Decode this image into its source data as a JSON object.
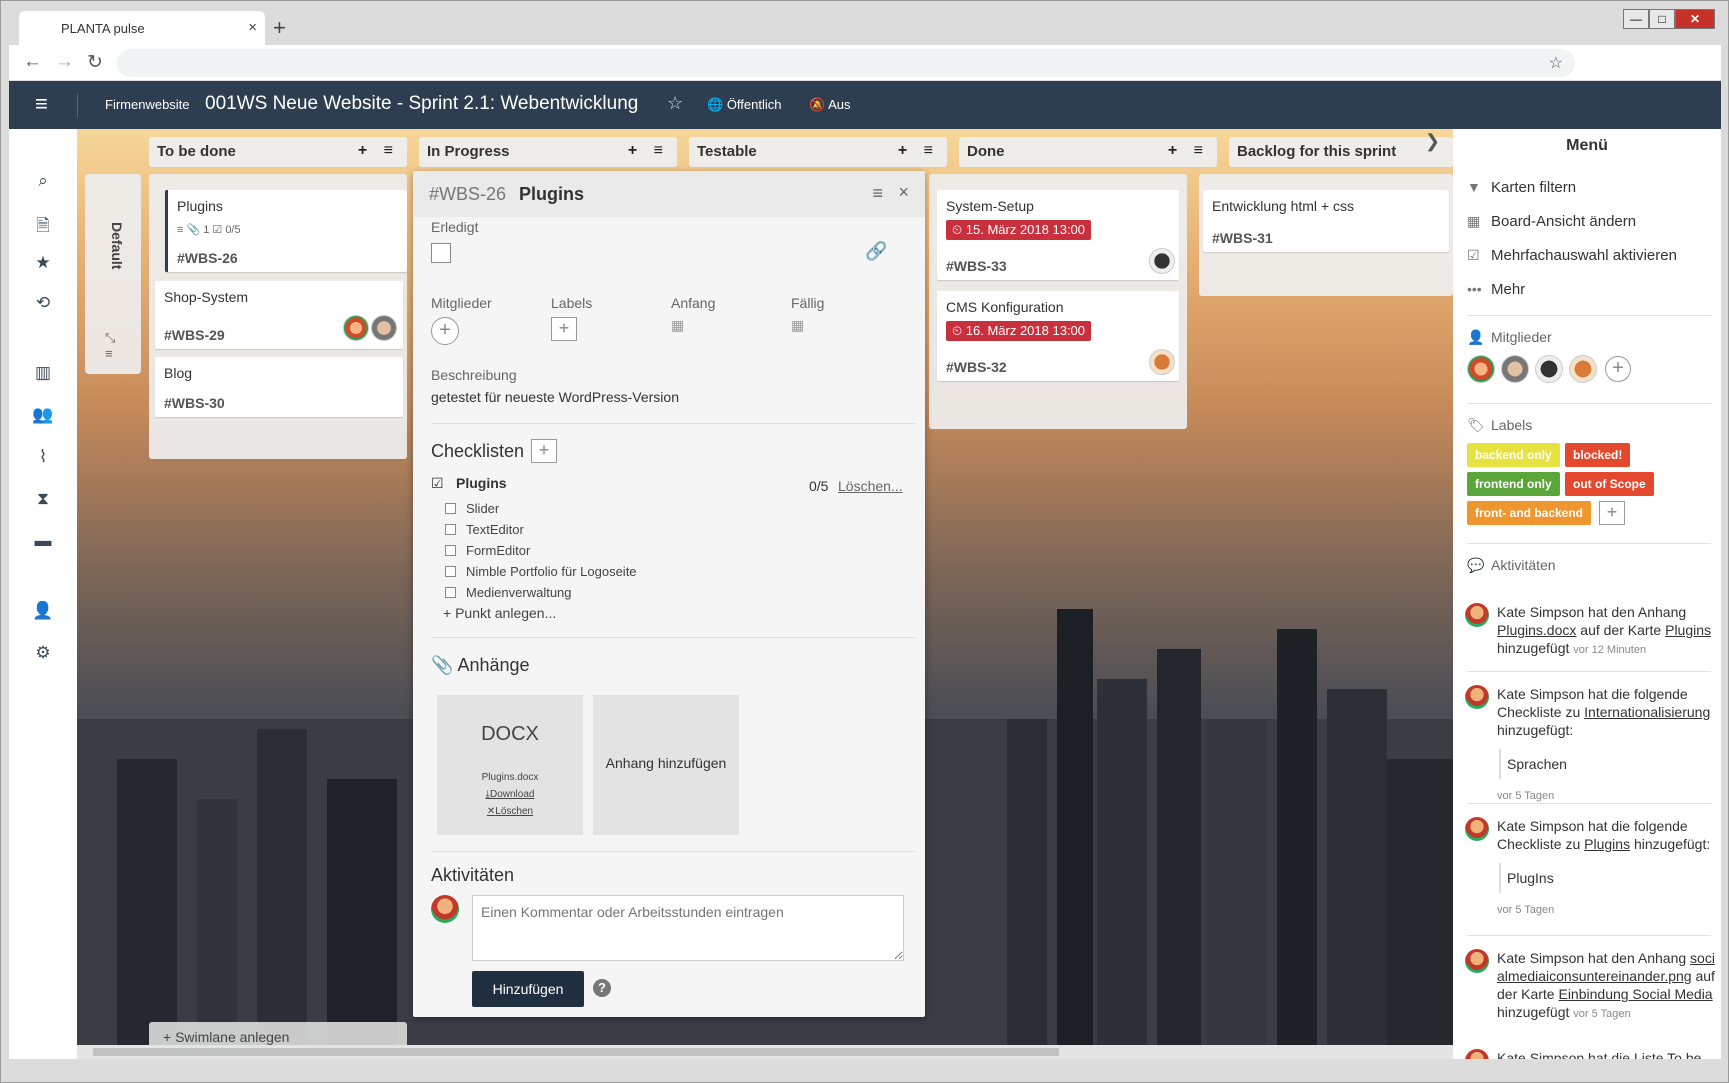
{
  "browser": {
    "tab_title": "PLANTA pulse",
    "tab_close": "×",
    "new_tab": "+",
    "win_min": "—",
    "win_max": "□",
    "win_close": "✕",
    "back": "←",
    "forward": "→",
    "reload": "↻",
    "bookmark_star": "☆"
  },
  "header": {
    "menu_icon": "≡",
    "project": "Firmenwebsite",
    "title": "001WS Neue Website - Sprint 2.1: Webentwicklung",
    "favorite_icon": "☆",
    "visibility": "Öffentlich",
    "notifications": "Aus"
  },
  "rail": {
    "icons": [
      "search-icon",
      "new-document-icon",
      "star-icon",
      "history-icon",
      "board-icon",
      "team-icon",
      "activity-icon",
      "hourglass-icon",
      "archive-icon",
      "user-icon",
      "settings-icon"
    ]
  },
  "swimlane": {
    "label": "Default",
    "add_swimlane": "+ Swimlane anlegen"
  },
  "columns": [
    {
      "title": "To be done",
      "actions": "+ ≡"
    },
    {
      "title": "In Progress",
      "actions": "+ ≡"
    },
    {
      "title": "Testable",
      "actions": "+ ≡"
    },
    {
      "title": "Done",
      "actions": "+ ≡"
    },
    {
      "title": "Backlog for this sprint",
      "actions": ""
    }
  ],
  "cards": {
    "plugins": {
      "title": "Plugins",
      "meta": "≡  📎 1  ☑ 0/5",
      "id": "#WBS-26"
    },
    "shop": {
      "title": "Shop-System",
      "id": "#WBS-29"
    },
    "blog": {
      "title": "Blog",
      "id": "#WBS-30"
    },
    "setup": {
      "title": "System-Setup",
      "due": "15. März 2018 13:00",
      "id": "#WBS-33"
    },
    "cms": {
      "title": "CMS Konfiguration",
      "due": "16. März 2018 13:00",
      "id": "#WBS-32"
    },
    "html": {
      "title": "Entwicklung html + css",
      "id": "#WBS-31"
    }
  },
  "detail": {
    "id": "#WBS-26",
    "name": "Plugins",
    "menu_icon": "≡",
    "close_icon": "×",
    "done_label": "Erledigt",
    "members_label": "Mitglieder",
    "labels_label": "Labels",
    "start_label": "Anfang",
    "due_label": "Fällig",
    "description_label": "Beschreibung",
    "description": "getestet für neueste WordPress-Version",
    "checklists_label": "Checklisten",
    "checklist_name": "Plugins",
    "checklist_progress": "0/5",
    "checklist_delete": "Löschen...",
    "checklist_items": [
      "Slider",
      "TextEditor",
      "FormEditor",
      "Nimble Portfolio für Logoseite",
      "Medienverwaltung"
    ],
    "add_item": "+ Punkt anlegen...",
    "attachments_label": "Anhänge",
    "attachment": {
      "type": "DOCX",
      "file": "Plugins.docx",
      "download": "Download",
      "delete": "Löschen"
    },
    "add_attachment": "Anhang hinzufügen",
    "activities_label": "Aktivitäten",
    "comment_placeholder": "Einen Kommentar oder Arbeitsstunden eintragen",
    "submit": "Hinzufügen",
    "help": "?"
  },
  "menu": {
    "title": "Menü",
    "items": [
      "Karten filtern",
      "Board-Ansicht ändern",
      "Mehrfachauswahl aktivieren",
      "Mehr"
    ],
    "members_label": "Mitglieder",
    "labels_label": "Labels",
    "labels": [
      {
        "text": "backend only",
        "color": "#e8e240"
      },
      {
        "text": "blocked!",
        "color": "#e4492e"
      },
      {
        "text": "frontend only",
        "color": "#5aa63a"
      },
      {
        "text": "out of Scope",
        "color": "#e4492e"
      },
      {
        "text": "front- and backend",
        "color": "#f0962e"
      }
    ],
    "activities_label": "Aktivitäten",
    "activities": [
      {
        "a": "Kate Simpson hat den Anhang ",
        "l1": "Plugins.docx",
        "b": " auf der Karte ",
        "l2": "Plugins",
        "c": " hinzugefügt",
        "time": "vor 12 Minuten"
      },
      {
        "a": "Kate Simpson hat die folgende Checkliste zu ",
        "l1": "Internationalisierung",
        "c": " hinzugefügt:",
        "quote": "Sprachen",
        "time": "vor 5 Tagen"
      },
      {
        "a": "Kate Simpson hat die folgende Checkliste zu ",
        "l1": "Plugins",
        "c": " hinzugefügt:",
        "quote": "PlugIns",
        "time": "vor 5 Tagen"
      },
      {
        "a": "Kate Simpson hat den Anhang ",
        "l1": "socialmediaiconsuntereinander.png",
        "b": " auf der Karte ",
        "l2": "Einbindung Social Media",
        "c": " hinzugefügt",
        "time": "vor 5 Tagen"
      },
      {
        "a": "Kate Simpson hat die Liste To be"
      }
    ]
  },
  "colors": {
    "header": "#2c3e50",
    "due": "#c9303e",
    "button": "#1f2f40"
  }
}
